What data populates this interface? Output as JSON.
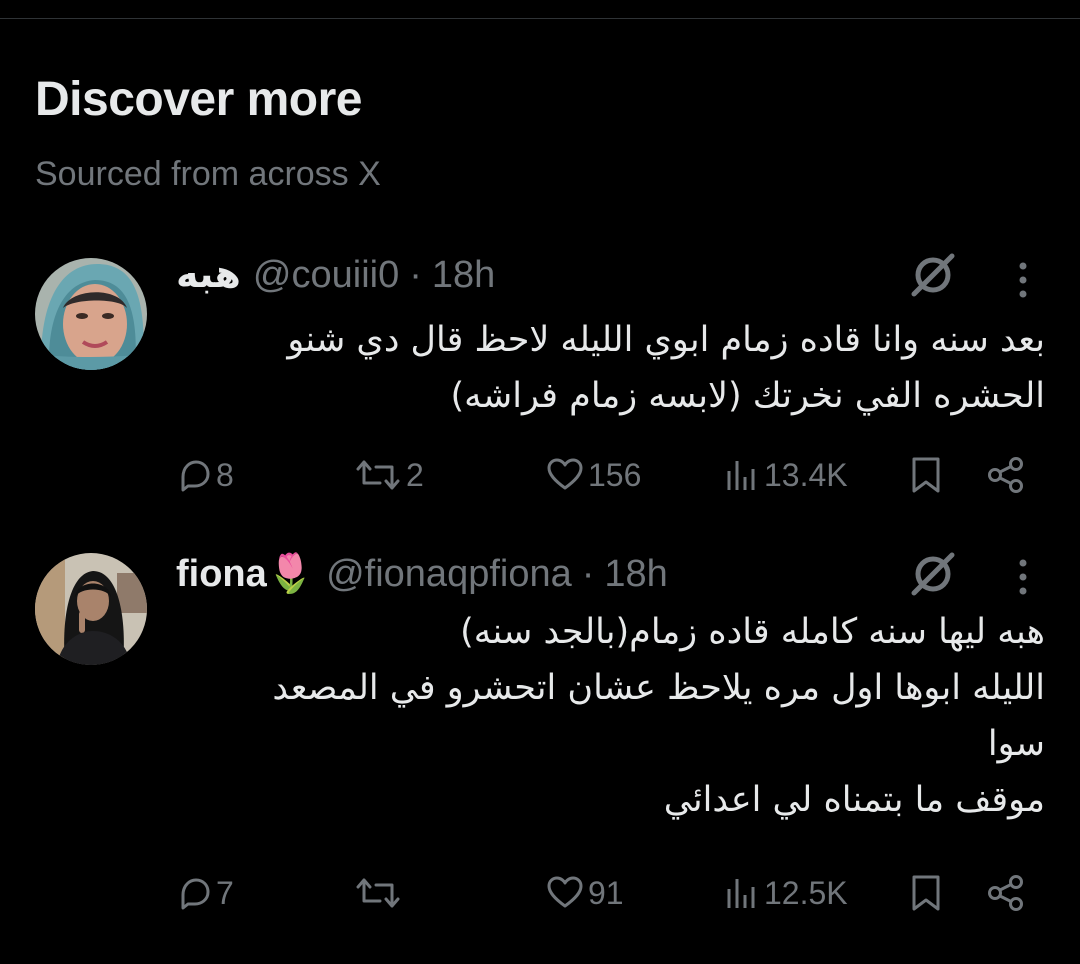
{
  "section": {
    "title": "Discover more",
    "subtitle": "Sourced from across X"
  },
  "posts": [
    {
      "display_name": "هبه",
      "handle": "@couiii0",
      "separator": "·",
      "time": "18h",
      "text_lines": [
        "بعد سنه وانا قاده زمام ابوي الليله لاحظ قال دي شنو",
        "الحشره الفي نخرتك (لابسه زمام فراشه)"
      ],
      "replies": "8",
      "reposts": "2",
      "likes": "156",
      "views": "13.4K"
    },
    {
      "display_name": "fiona🌷",
      "handle": "@fionaqpfiona",
      "separator": "·",
      "time": "18h",
      "text_lines": [
        "هبه ليها سنه كامله قاده زمام(بالجد سنه)",
        "الليله ابوها اول مره يلاحظ عشان اتحشرو في المصعد",
        "سوا",
        "موقف ما بتمناه لي اعدائي"
      ],
      "replies": "7",
      "reposts": "",
      "likes": "91",
      "views": "12.5K"
    }
  ],
  "icons": {
    "reply": "reply-icon",
    "repost": "repost-icon",
    "like": "like-icon",
    "views": "views-icon",
    "bookmark": "bookmark-icon",
    "share": "share-icon",
    "grok": "grok-icon",
    "more": "more-icon"
  },
  "colors": {
    "background": "#000000",
    "text": "#e7e9ea",
    "secondary": "#71767b"
  }
}
